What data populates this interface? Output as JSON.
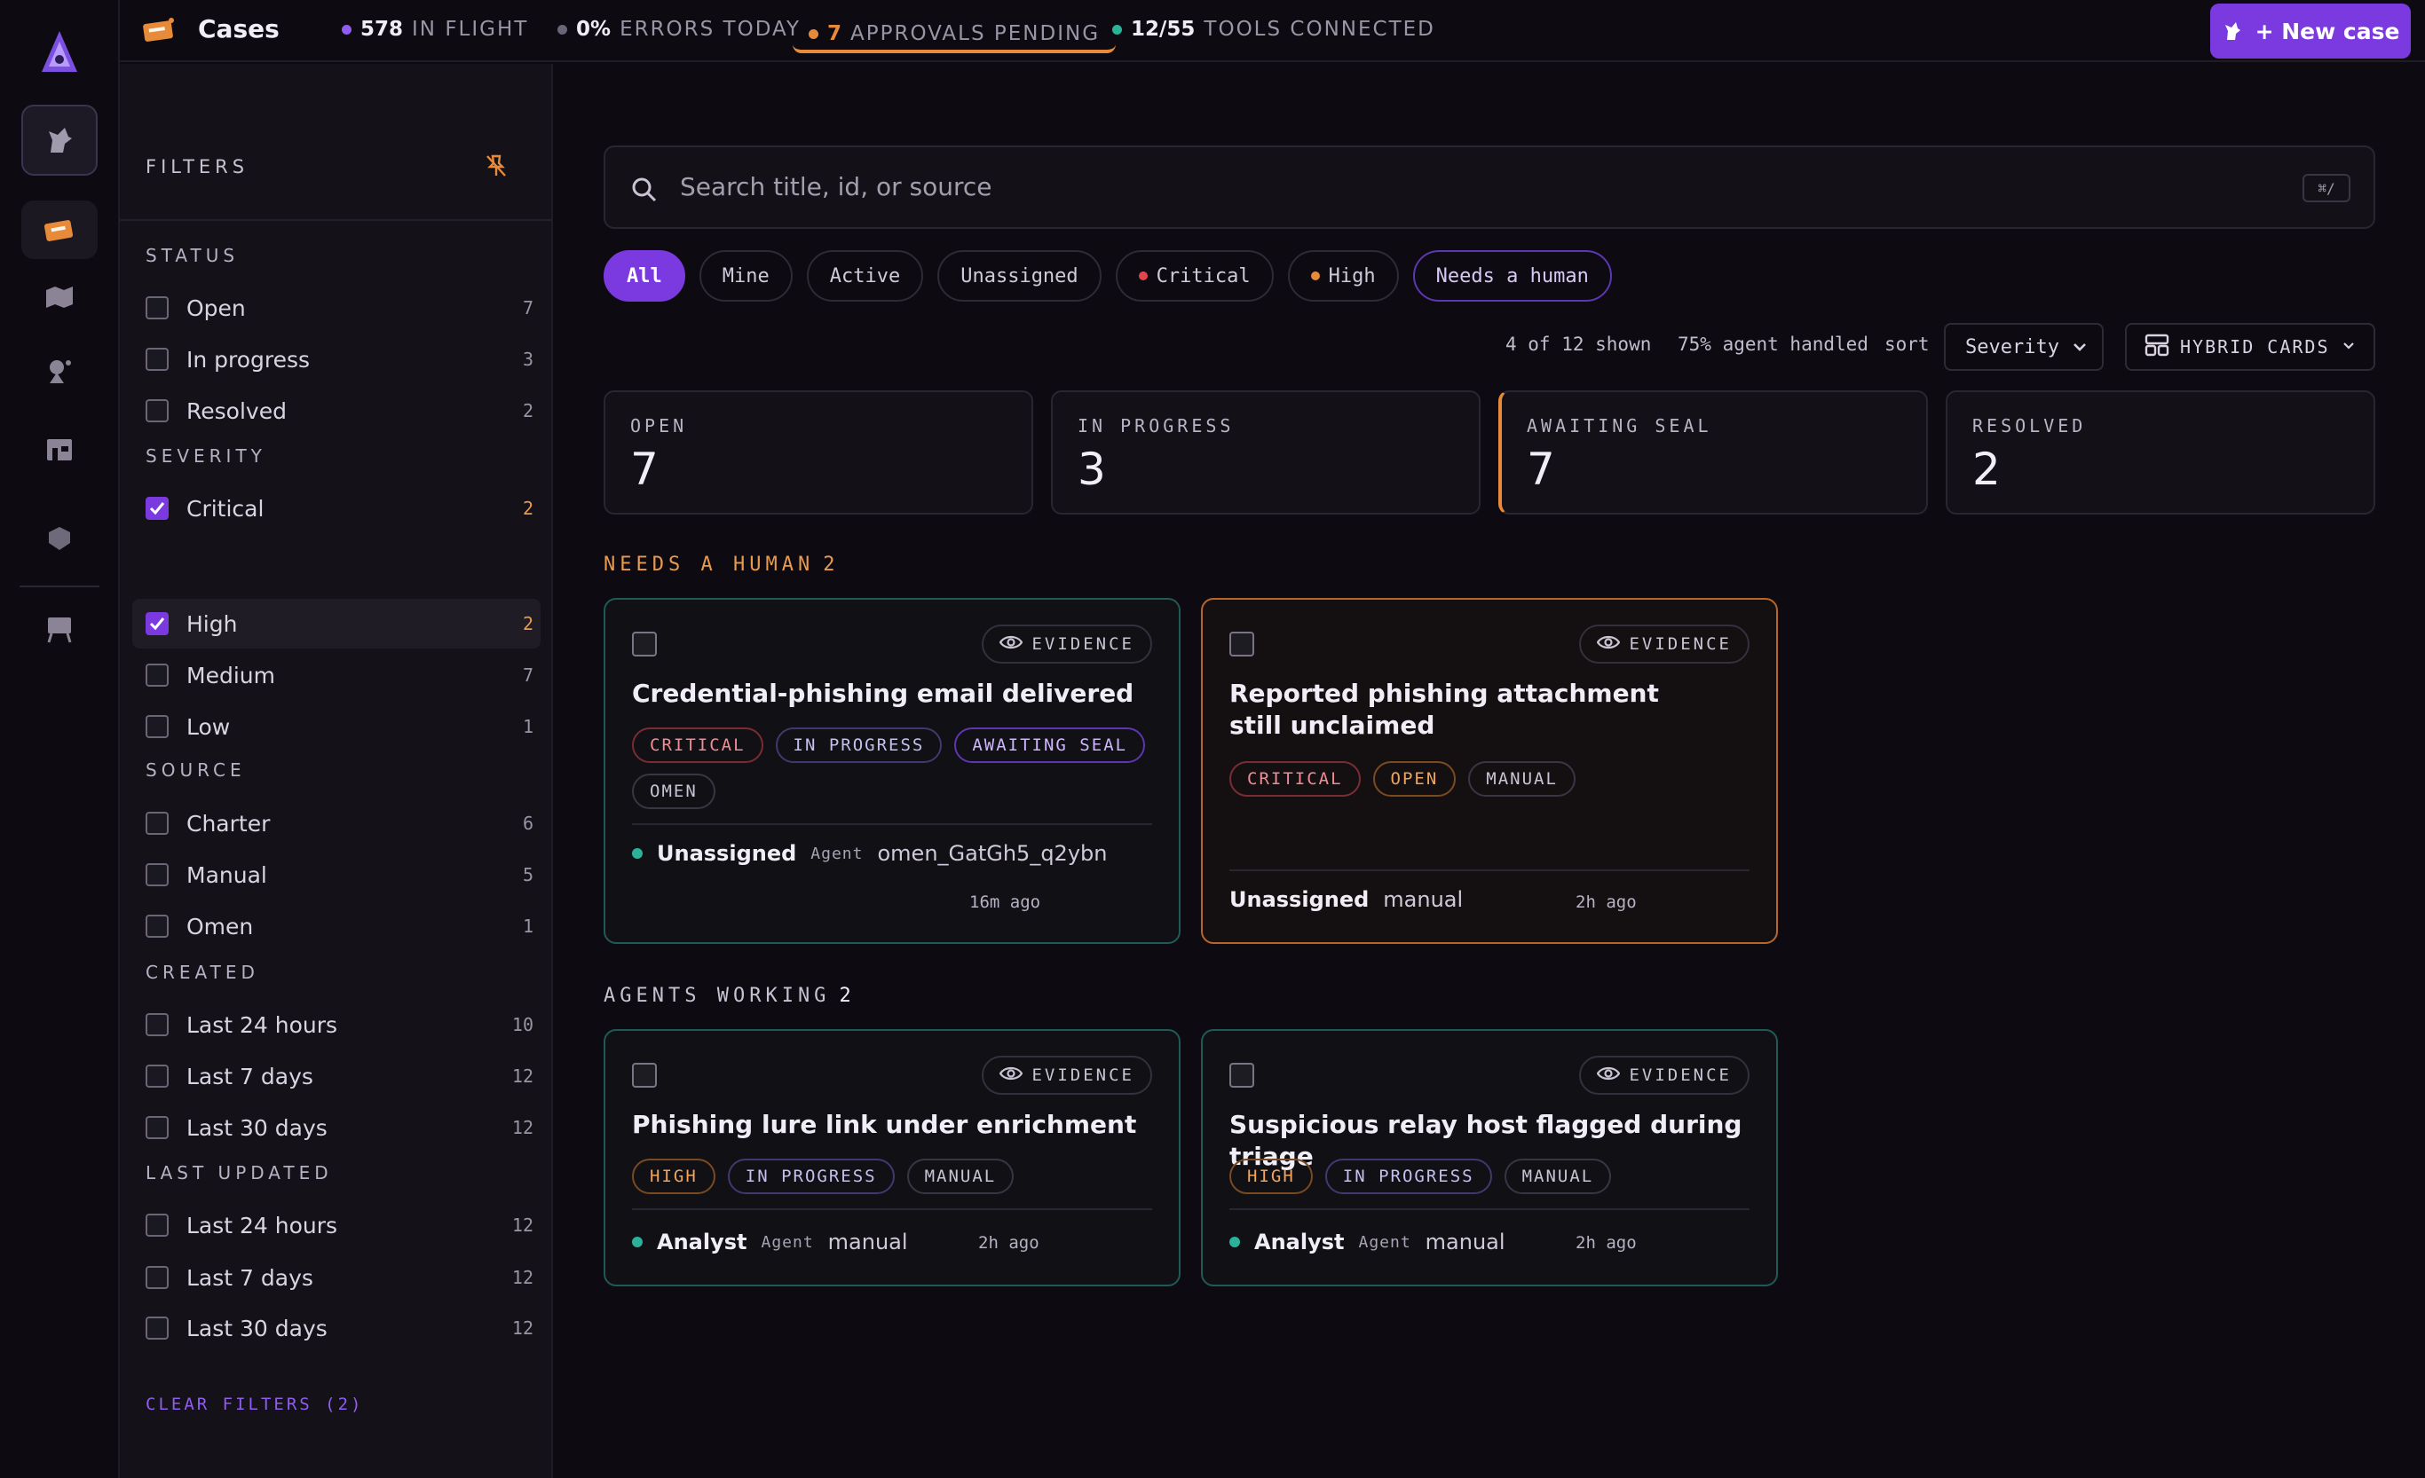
{
  "topbar": {
    "title": "Cases",
    "stats": [
      {
        "num": "578",
        "label": "IN FLIGHT",
        "color": "#8f5df0"
      },
      {
        "num": "0%",
        "label": "ERRORS TODAY",
        "color": "#6b6577"
      },
      {
        "num": "7",
        "label": "APPROVALS PENDING",
        "color": "#e78a3a"
      },
      {
        "num": "12/55",
        "label": "TOOLS CONNECTED",
        "color": "#2bb39a"
      }
    ],
    "new_case_label": "+ New case"
  },
  "filters": {
    "title": "FILTERS",
    "clear_label": "CLEAR FILTERS (2)",
    "groups": {
      "status": {
        "label": "STATUS",
        "options": [
          {
            "label": "Open",
            "count": "7"
          },
          {
            "label": "In progress",
            "count": "3"
          },
          {
            "label": "Resolved",
            "count": "2"
          }
        ]
      },
      "severity": {
        "label": "SEVERITY",
        "options": [
          {
            "label": "Critical",
            "count": "2",
            "checked": true
          },
          {
            "label": "High",
            "count": "2",
            "checked": true
          },
          {
            "label": "Medium",
            "count": "7"
          },
          {
            "label": "Low",
            "count": "1"
          }
        ]
      },
      "source": {
        "label": "SOURCE",
        "options": [
          {
            "label": "Charter",
            "count": "6"
          },
          {
            "label": "Manual",
            "count": "5"
          },
          {
            "label": "Omen",
            "count": "1"
          }
        ]
      },
      "created": {
        "label": "CREATED",
        "options": [
          {
            "label": "Last 24 hours",
            "count": "10"
          },
          {
            "label": "Last 7 days",
            "count": "12"
          },
          {
            "label": "Last 30 days",
            "count": "12"
          }
        ]
      },
      "updated": {
        "label": "LAST UPDATED",
        "options": [
          {
            "label": "Last 24 hours",
            "count": "12"
          },
          {
            "label": "Last 7 days",
            "count": "12"
          },
          {
            "label": "Last 30 days",
            "count": "12"
          }
        ]
      }
    }
  },
  "search": {
    "placeholder": "Search title, id, or source",
    "shortcut": "⌘/"
  },
  "chips": [
    "All",
    "Mine",
    "Active",
    "Unassigned",
    "Critical",
    "High",
    "Needs a human"
  ],
  "meta": {
    "shown": "4 of 12 shown",
    "handled": "75% agent handled",
    "sort_label": "sort",
    "sort_value": "Severity",
    "view_value": "HYBRID CARDS"
  },
  "kpis": [
    {
      "label": "OPEN",
      "value": "7"
    },
    {
      "label": "IN PROGRESS",
      "value": "3"
    },
    {
      "label": "AWAITING SEAL",
      "value": "7"
    },
    {
      "label": "RESOLVED",
      "value": "2"
    }
  ],
  "sections": {
    "human": {
      "label": "NEEDS A HUMAN",
      "count": "2"
    },
    "agents": {
      "label": "AGENTS WORKING",
      "count": "2"
    }
  },
  "evidence_label": "EVIDENCE",
  "agent_label": "Agent",
  "cards": [
    {
      "title": "Credential-phishing email delivered",
      "tags": [
        "CRITICAL",
        "IN PROGRESS",
        "AWAITING SEAL",
        "OMEN"
      ],
      "assignee": "Unassigned",
      "source": "omen_GatGh5_q2ybn",
      "time": "16m ago"
    },
    {
      "title": "Reported phishing attachment still unclaimed",
      "tags": [
        "CRITICAL",
        "OPEN",
        "MANUAL"
      ],
      "assignee": "Unassigned",
      "source": "manual",
      "time": "2h ago"
    },
    {
      "title": "Phishing lure link under enrichment",
      "tags": [
        "HIGH",
        "IN PROGRESS",
        "MANUAL"
      ],
      "assignee": "Analyst",
      "source": "manual",
      "time": "2h ago"
    },
    {
      "title": "Suspicious relay host flagged during triage",
      "tags": [
        "HIGH",
        "IN PROGRESS",
        "MANUAL"
      ],
      "assignee": "Analyst",
      "source": "manual",
      "time": "2h ago"
    }
  ]
}
